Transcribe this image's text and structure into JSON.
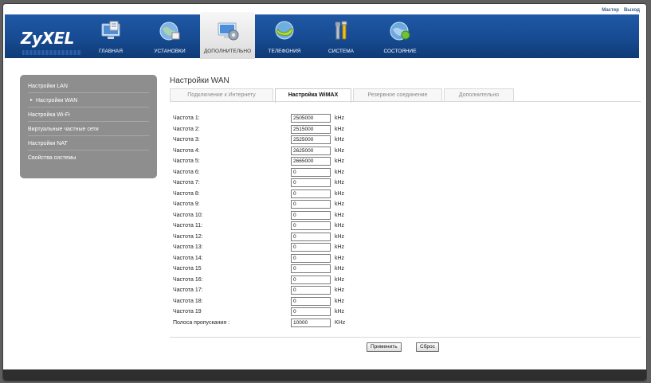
{
  "top_links": [
    "Мастер",
    "Выход"
  ],
  "header": {
    "logo": "ZyXEL",
    "nav": [
      {
        "label": "ГЛАВНАЯ",
        "icon": "monitor-window-icon"
      },
      {
        "label": "УСТАНОВКИ",
        "icon": "globe-network-icon"
      },
      {
        "label": "ДОПОЛНИТЕЛЬНО",
        "icon": "monitor-gear-icon",
        "active": true
      },
      {
        "label": "ТЕЛЕФОНИЯ",
        "icon": "phone-globe-icon"
      },
      {
        "label": "СИСТЕМА",
        "icon": "tools-icon"
      },
      {
        "label": "СОСТОЯНИЕ",
        "icon": "globe-status-icon"
      }
    ]
  },
  "sidebar": {
    "items": [
      {
        "label": "Настройки LAN"
      },
      {
        "label": "Настройки WAN",
        "sub": true
      },
      {
        "label": "Настройка Wi-Fi"
      },
      {
        "label": "Виртуальные частные сети"
      },
      {
        "label": "Настройки NAT"
      },
      {
        "label": "Свойства системы"
      }
    ]
  },
  "page_title": "Настройки WAN",
  "tabs": [
    {
      "label": "Подключение к Интернету"
    },
    {
      "label": "Настройка WiMAX",
      "active": true
    },
    {
      "label": "Резервное соединение"
    },
    {
      "label": "Дополнительно"
    }
  ],
  "form": {
    "rows": [
      {
        "label": "Частота 1:",
        "value": "2505000",
        "unit": "kHz"
      },
      {
        "label": "Частота 2:",
        "value": "2515000",
        "unit": "kHz"
      },
      {
        "label": "Частота 3:",
        "value": "2525000",
        "unit": "kHz"
      },
      {
        "label": "Частота 4:",
        "value": "2625000",
        "unit": "kHz"
      },
      {
        "label": "Частота 5:",
        "value": "2665000",
        "unit": "kHz"
      },
      {
        "label": "Частота 6:",
        "value": "0",
        "unit": "kHz"
      },
      {
        "label": "Частота 7:",
        "value": "0",
        "unit": "kHz"
      },
      {
        "label": "Частота 8:",
        "value": "0",
        "unit": "kHz"
      },
      {
        "label": "Частота 9:",
        "value": "0",
        "unit": "kHz"
      },
      {
        "label": "Частота 10:",
        "value": "0",
        "unit": "kHz"
      },
      {
        "label": "Частота 11:",
        "value": "0",
        "unit": "kHz"
      },
      {
        "label": "Частота 12:",
        "value": "0",
        "unit": "kHz"
      },
      {
        "label": "Частота 13:",
        "value": "0",
        "unit": "kHz"
      },
      {
        "label": "Частота 14:",
        "value": "0",
        "unit": "kHz"
      },
      {
        "label": "Частота 15",
        "value": "0",
        "unit": "kHz"
      },
      {
        "label": "Частота 16:",
        "value": "0",
        "unit": "kHz"
      },
      {
        "label": "Частота 17:",
        "value": "0",
        "unit": "kHz"
      },
      {
        "label": "Частота 18:",
        "value": "0",
        "unit": "kHz"
      },
      {
        "label": "Частота 19",
        "value": "0",
        "unit": "kHz"
      },
      {
        "label": "Полоса пропускания :",
        "value": "10000",
        "unit": "KHz"
      }
    ]
  },
  "buttons": {
    "apply": "Применить",
    "reset": "Сброс"
  }
}
